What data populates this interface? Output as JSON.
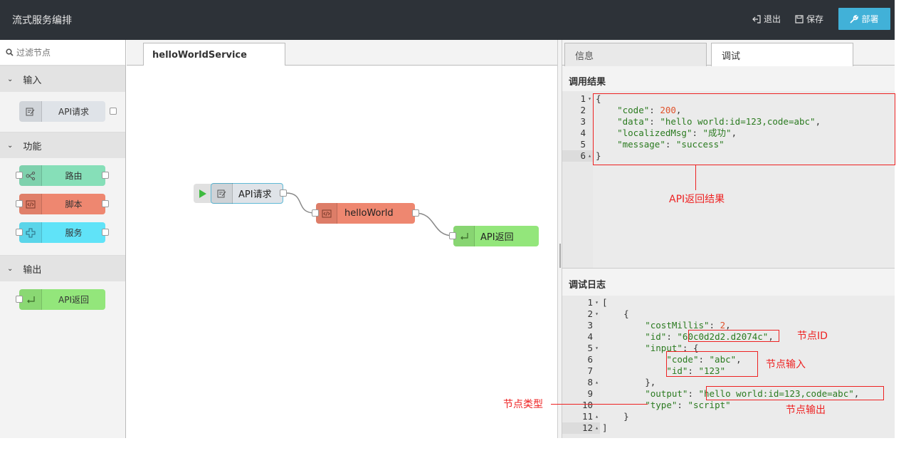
{
  "app": {
    "title": "流式服务编排"
  },
  "header": {
    "exit_label": "退出",
    "save_label": "保存",
    "deploy_label": "部署"
  },
  "palette": {
    "filter_placeholder": "过滤节点",
    "categories": [
      {
        "label": "输入",
        "nodes": [
          {
            "label": "API请求",
            "color": "#dfe3e8"
          }
        ]
      },
      {
        "label": "功能",
        "nodes": [
          {
            "label": "路由",
            "color": "#86dfb8"
          },
          {
            "label": "脚本",
            "color": "#ee8770"
          },
          {
            "label": "服务",
            "color": "#60e3f8"
          }
        ]
      },
      {
        "label": "输出",
        "nodes": [
          {
            "label": "API返回",
            "color": "#93e67b"
          }
        ]
      }
    ]
  },
  "workspace": {
    "tab_label": "helloWorldService",
    "nodes": {
      "request": "API请求",
      "script": "helloWorld",
      "response": "API返回"
    }
  },
  "sidebar": {
    "tabs": {
      "info": "信息",
      "debug": "调试"
    },
    "result_title": "调用结果",
    "log_title": "调试日志",
    "result_annotation": "API返回结果",
    "log_annotations": {
      "id": "节点ID",
      "input": "节点输入",
      "output": "节点输出",
      "type": "节点类型"
    }
  },
  "result_code": [
    {
      "n": "1",
      "fold": "▾",
      "text": "{"
    },
    {
      "n": "2",
      "text": "    \"code\": 200,"
    },
    {
      "n": "3",
      "text": "    \"data\": \"hello world:id=123,code=abc\","
    },
    {
      "n": "4",
      "text": "    \"localizedMsg\": \"成功\","
    },
    {
      "n": "5",
      "text": "    \"message\": \"success\""
    },
    {
      "n": "6",
      "fold": "▴",
      "text": "}"
    }
  ],
  "log_code": [
    {
      "n": "1",
      "fold": "▾",
      "text": "["
    },
    {
      "n": "2",
      "fold": "▾",
      "text": "    {"
    },
    {
      "n": "3",
      "text": "        \"costMillis\": 2,"
    },
    {
      "n": "4",
      "text": "        \"id\": \"60c0d2d2.d2074c\","
    },
    {
      "n": "5",
      "fold": "▾",
      "text": "        \"input\": {"
    },
    {
      "n": "6",
      "text": "            \"code\": \"abc\","
    },
    {
      "n": "7",
      "text": "            \"id\": \"123\""
    },
    {
      "n": "8",
      "fold": "▴",
      "text": "        },"
    },
    {
      "n": "9",
      "text": "        \"output\": \"hello world:id=123,code=abc\","
    },
    {
      "n": "10",
      "text": "        \"type\": \"script\""
    },
    {
      "n": "11",
      "fold": "▴",
      "text": "    }"
    },
    {
      "n": "12",
      "fold": "▴",
      "text": "]"
    }
  ],
  "colors": {
    "header_bg": "#2d3238",
    "deploy_bg": "#41b1d8",
    "annotation_red": "#ee2222",
    "play_green": "#3fbb3f"
  }
}
